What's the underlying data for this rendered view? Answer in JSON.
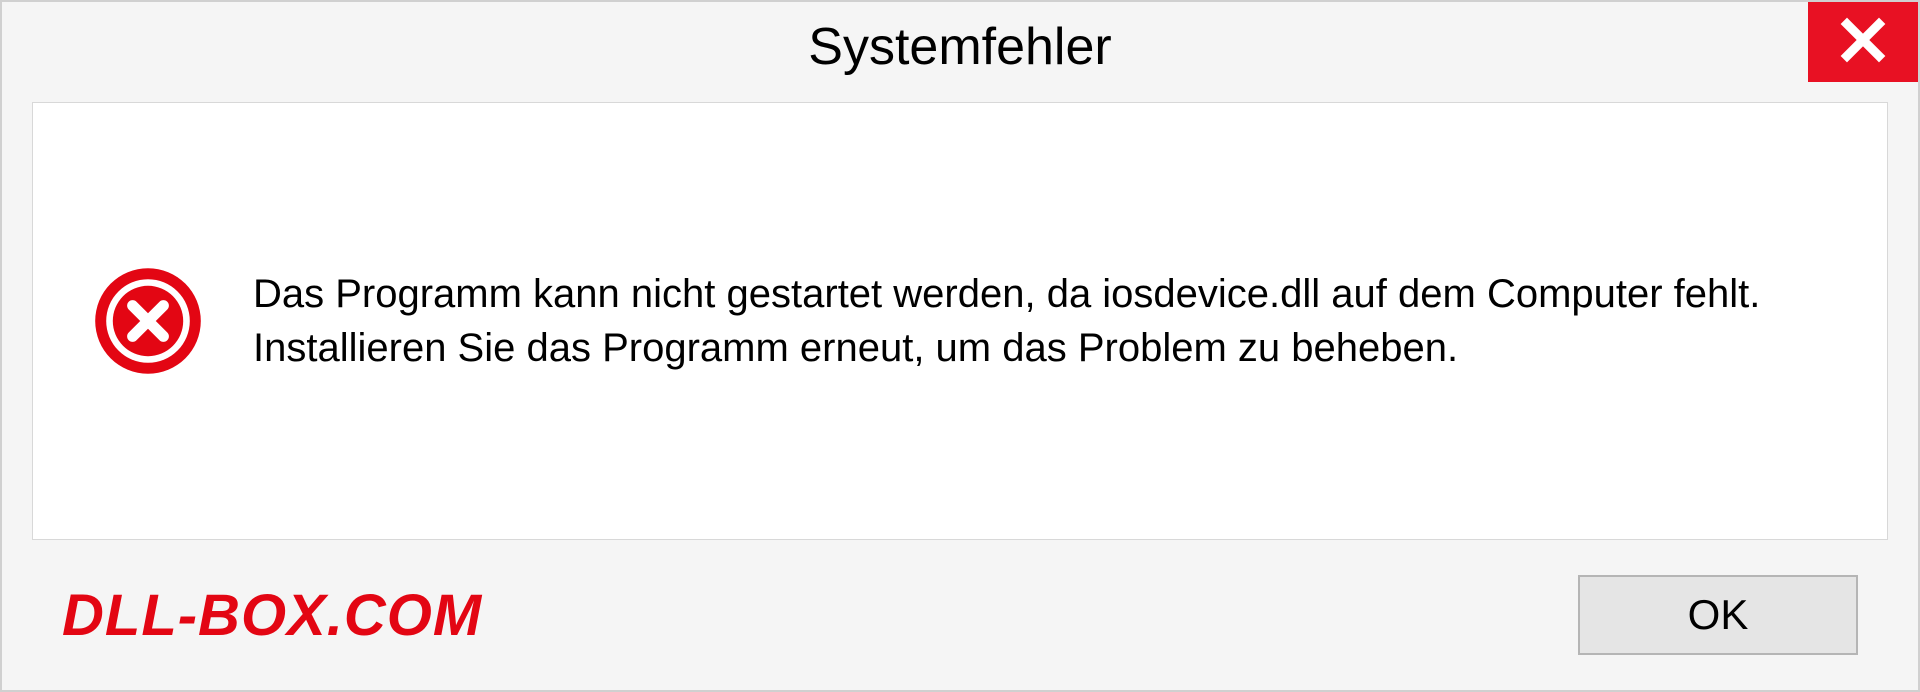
{
  "dialog": {
    "title": "Systemfehler",
    "message": "Das Programm kann nicht gestartet werden, da iosdevice.dll auf dem Computer fehlt. Installieren Sie das Programm erneut, um das Problem zu beheben.",
    "ok_label": "OK"
  },
  "watermark": "DLL-BOX.COM"
}
